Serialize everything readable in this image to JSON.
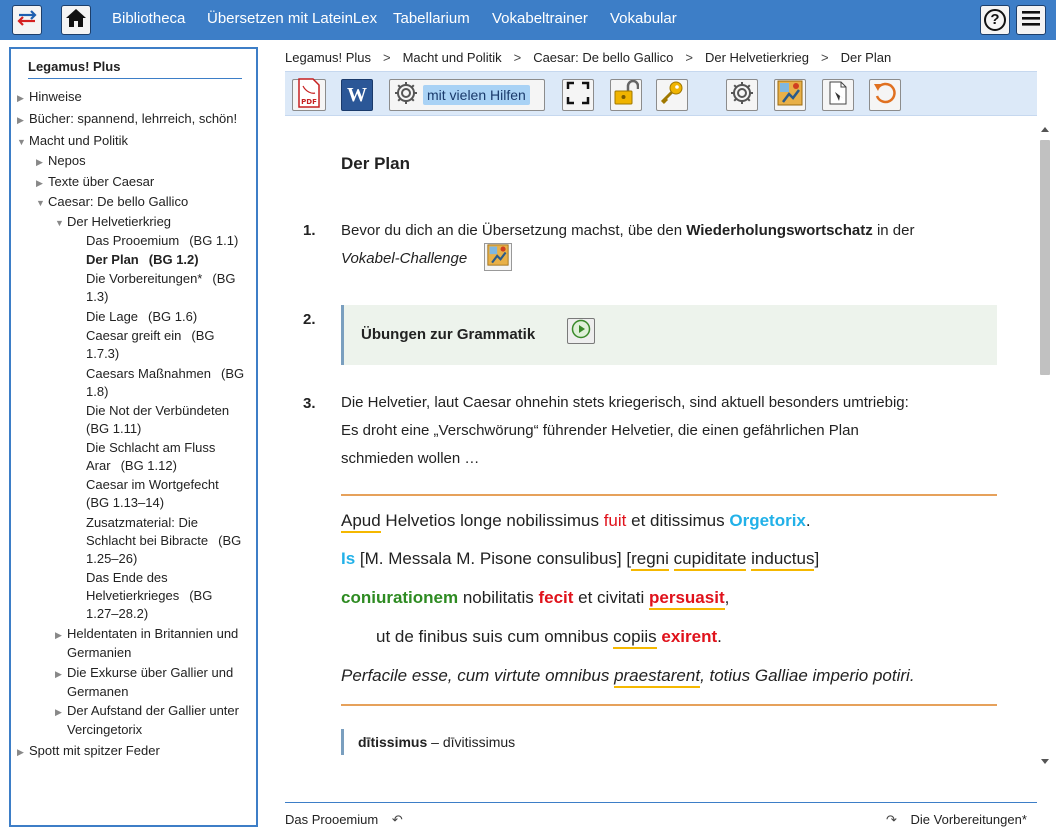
{
  "topbar": {
    "nav": [
      "Bibliotheca",
      "Übersetzen mit LateinLex",
      "Tabellarium",
      "Vokabeltrainer",
      "Vokabular"
    ],
    "help_label": "?"
  },
  "sidebar": {
    "title": "Legamus! Plus",
    "items": [
      {
        "label": "Hinweise"
      },
      {
        "label": "Bücher: spannend, lehrreich, schön!"
      },
      {
        "label": "Macht und Politik"
      },
      {
        "label": "Nepos"
      },
      {
        "label": "Texte über Caesar"
      },
      {
        "label": "Caesar: De bello Gallico"
      },
      {
        "label": "Der Helvetierkrieg"
      },
      {
        "label": "Heldentaten in Britannien und"
      },
      {
        "label": "Germanien"
      },
      {
        "label": "Die Exkurse über Gallier und"
      },
      {
        "label": "Germanen"
      },
      {
        "label": "Der Aufstand der Gallier unter"
      },
      {
        "label": "Vercingetorix"
      },
      {
        "label": "Spott mit spitzer Feder"
      }
    ],
    "leaves": [
      {
        "lines": [
          "Das Prooemium",
          "(BG 1.1)"
        ]
      },
      {
        "lines": [
          "Der Plan",
          "(BG 1.2)"
        ]
      },
      {
        "lines": [
          "Die Vorbereitungen*",
          "(BG",
          "1.3)"
        ]
      },
      {
        "lines": [
          "Die Lage",
          "(BG 1.6)"
        ]
      },
      {
        "lines": [
          "Caesar greift ein",
          "(BG",
          "1.7.3)"
        ]
      },
      {
        "lines": [
          "Caesars Maßnahmen",
          "(BG",
          "1.8)"
        ]
      },
      {
        "lines": [
          "Die Not der Verbündeten",
          "(BG 1.11)"
        ]
      },
      {
        "lines": [
          "Die Schlacht am Fluss",
          "Arar",
          "(BG 1.12)"
        ]
      },
      {
        "lines": [
          "Caesar im Wortgefecht",
          "(BG 1.13–14)"
        ]
      },
      {
        "lines": [
          "Zusatzmaterial: Die",
          "Schlacht bei Bibracte",
          "(BG",
          "1.25–26)"
        ]
      },
      {
        "lines": [
          "Das Ende des",
          "Helvetierkrieges",
          "(BG",
          "1.27–28.2)"
        ]
      }
    ]
  },
  "breadcrumb": [
    "Legamus! Plus",
    "Macht und Politik",
    "Caesar: De bello Gallico",
    "Der Helvetierkrieg",
    "Der Plan"
  ],
  "toolbar": {
    "pdf_label": "PDF",
    "word_label": "W",
    "help_mode_label": "mit vielen Hilfen"
  },
  "content": {
    "title": "Der Plan",
    "step1": {
      "num": "1.",
      "pre": "Bevor du dich an die Übersetzung machst, übe den ",
      "bold": "Wiederholungswortschatz",
      "post": " in der",
      "italic": "Vokabel-Challenge"
    },
    "step2": {
      "num": "2.",
      "label": "Übungen zur Grammatik"
    },
    "step3": {
      "num": "3.",
      "lines": [
        "Die Helvetier, laut Caesar ohnehin stets kriegerisch, sind aktuell besonders umtriebig:",
        "Es droht eine „Verschwörung“ führender Helvetier, die einen gefährlichen Plan",
        "schmieden wollen …"
      ]
    },
    "latin": {
      "l1": {
        "w1": "Apud",
        "w2": " Helvetios longe nobilissimus ",
        "w3": "fuit",
        "w4": " et ditissimus ",
        "w5": "Orgetorix",
        "w6": "."
      },
      "l2": {
        "w1": "Is",
        "w2": " [M. Messala M. Pisone consulibus] [",
        "w3": "regni",
        "w4": " ",
        "w5": "cupiditate",
        "w6": " ",
        "w7": "inductus",
        "w8": "]"
      },
      "l3": {
        "w1": "coniurationem",
        "w2": " nobilitatis ",
        "w3": "fecit",
        "w4": " et civitati ",
        "w5": "persuasit",
        "w6": ","
      },
      "l4": {
        "w1": "ut de finibus suis cum omnibus ",
        "w2": "copiis",
        "w3": " ",
        "w4": "exirent",
        "w5": "."
      },
      "l5": {
        "w1": "Perfacile esse, cum virtute omnibus ",
        "w2": "praestarent",
        "w3": ", totius Galliae imperio potiri."
      }
    },
    "vocab": {
      "word": "dītissimus",
      "rest": " – dīvitissimus"
    }
  },
  "footer": {
    "prev": "Das Prooemium",
    "next": "Die Vorbereitungen*"
  },
  "colors": {
    "brand": "#3d7ec7",
    "red": "#e0121b",
    "blue": "#22b1e8",
    "green": "#2e8b22",
    "underline": "#f5b800",
    "rule": "#e6a15b"
  },
  "icons": [
    "switch-icon",
    "home-icon",
    "help-icon",
    "menu-icon",
    "pdf-icon",
    "word-icon",
    "gear-icon",
    "fullscreen-icon",
    "unlock-icon",
    "key-icon",
    "challenge-icon",
    "worksheet-icon",
    "reset-icon",
    "play-icon",
    "undo-arrow-icon",
    "redo-arrow-icon"
  ]
}
